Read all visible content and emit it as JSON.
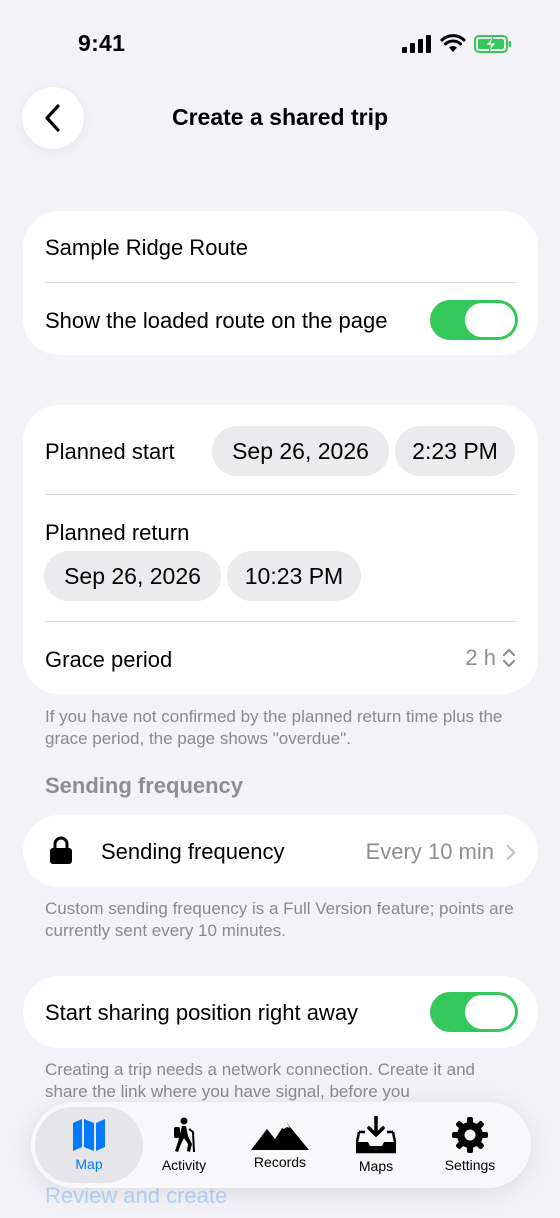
{
  "status_bar": {
    "time": "9:41"
  },
  "nav": {
    "title": "Create a shared trip"
  },
  "route_card": {
    "route_name": "Sample Ridge Route",
    "show_route_label": "Show the loaded route on the page",
    "show_route_on": true
  },
  "schedule_card": {
    "planned_start_label": "Planned start",
    "start_date": "Sep 26, 2026",
    "start_time": "2:23 PM",
    "planned_return_label": "Planned return",
    "return_date": "Sep 26, 2026",
    "return_time": "10:23 PM",
    "grace_label": "Grace period",
    "grace_value": "2 h"
  },
  "grace_footnote": "If you have not confirmed by the planned return time plus the grace period, the page shows \"overdue\".",
  "frequency_section": {
    "header": "Sending frequency",
    "row_label": "Sending frequency",
    "row_value": "Every 10 min",
    "footnote": "Custom sending frequency is a Full Version feature; points are currently sent every 10 minutes."
  },
  "sharing_card": {
    "label": "Start sharing position right away",
    "on": true
  },
  "network_footnote": "Creating a trip needs a network connection. Create it and share the link where you have signal, before you",
  "review_link": "Review and create",
  "tabbar": {
    "active": "map",
    "tabs": [
      {
        "id": "map",
        "label": "Map",
        "icon": "map-icon"
      },
      {
        "id": "activity",
        "label": "Activity",
        "icon": "hiker-icon"
      },
      {
        "id": "records",
        "label": "Records",
        "icon": "mountains-icon"
      },
      {
        "id": "maps",
        "label": "Maps",
        "icon": "tray-download-icon"
      },
      {
        "id": "settings",
        "label": "Settings",
        "icon": "gear-icon"
      }
    ]
  },
  "colors": {
    "background": "#F2F2F7",
    "accent": "#007AFF",
    "toggle_on": "#34C759",
    "secondary_text": "#8E8E93"
  }
}
